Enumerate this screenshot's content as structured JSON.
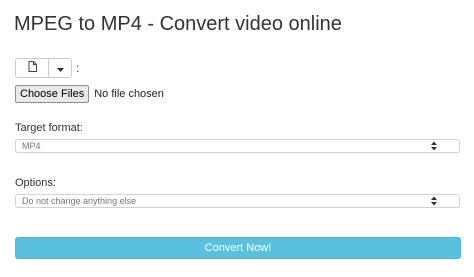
{
  "page": {
    "title": "MPEG to MP4 - Convert video online"
  },
  "source": {
    "file_icon": "file-icon",
    "caret_icon": "caret-down-icon",
    "suffix": ":"
  },
  "file_input": {
    "button_label": "Choose Files",
    "status": "No file chosen"
  },
  "target_format": {
    "label": "Target format:",
    "selected": "MP4"
  },
  "options": {
    "label": "Options:",
    "selected": "Do not change anything else"
  },
  "convert": {
    "label": "Convert Now!"
  },
  "colors": {
    "accent": "#5bc0de",
    "accent_border": "#46b8da",
    "text": "#333333"
  }
}
